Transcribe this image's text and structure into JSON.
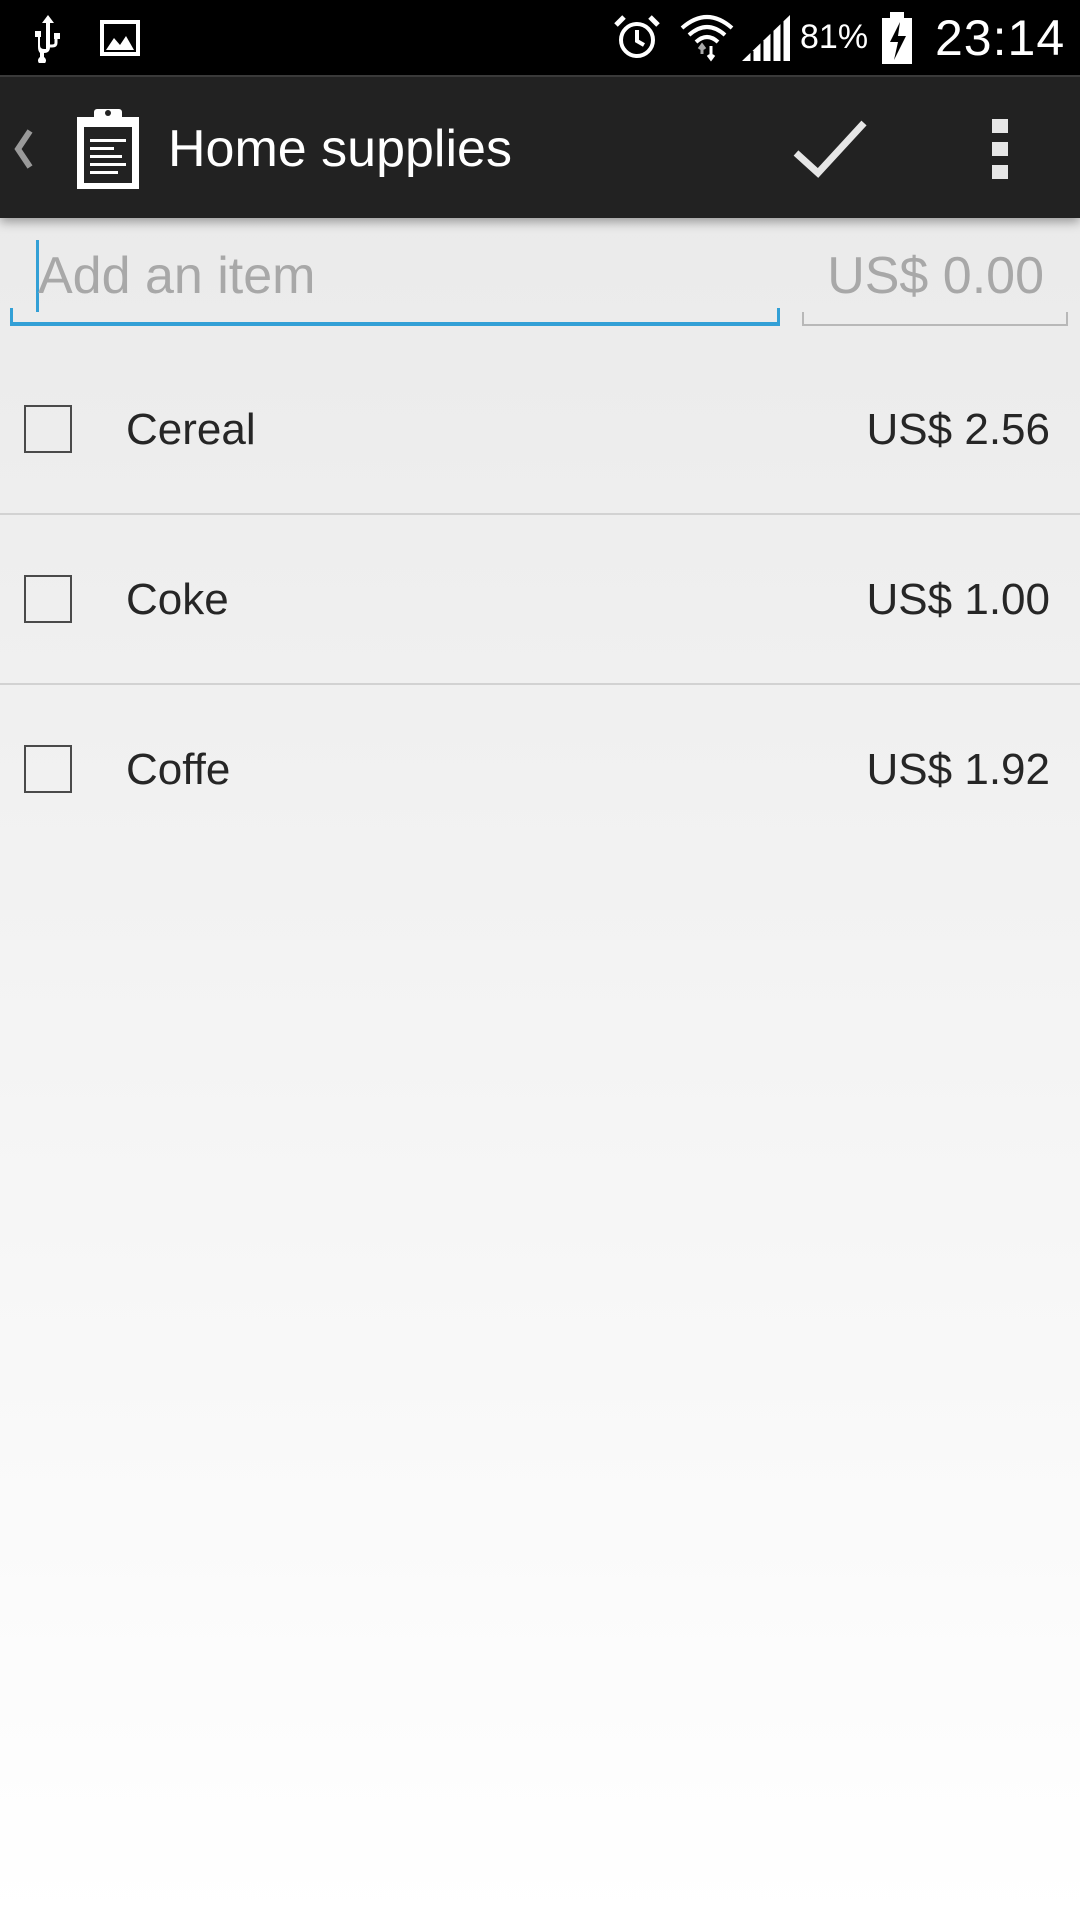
{
  "status_bar": {
    "battery_percent": "81%",
    "time": "23:14",
    "left_icons": [
      "usb-icon",
      "gallery-icon"
    ],
    "right_icons": [
      "alarm-icon",
      "wifi-icon",
      "signal-icon",
      "battery-charging-icon"
    ]
  },
  "action_bar": {
    "title": "Home supplies",
    "icons": [
      "up-caret-icon",
      "clipboard-icon",
      "checkmark-icon",
      "overflow-menu-icon"
    ]
  },
  "add_item": {
    "placeholder": "Add an item",
    "price_placeholder": "US$ 0.00",
    "accent_color": "#33a0d6"
  },
  "items": [
    {
      "name": "Cereal",
      "price": "US$ 2.56",
      "checked": false
    },
    {
      "name": "Coke",
      "price": "US$ 1.00",
      "checked": false
    },
    {
      "name": "Coffe",
      "price": "US$ 1.92",
      "checked": false
    }
  ]
}
